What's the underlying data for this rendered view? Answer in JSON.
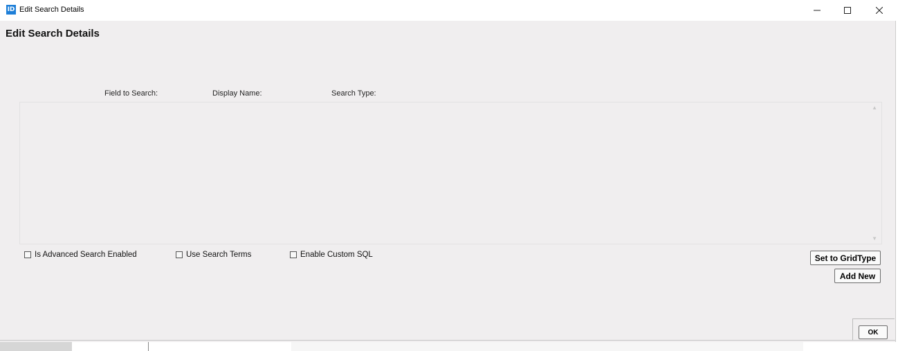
{
  "window": {
    "icon_text": "ID",
    "title": "Edit Search Details",
    "minimize_glyph": "—",
    "maximize_glyph": "☐",
    "close_glyph": "✕"
  },
  "page": {
    "heading": "Edit Search Details"
  },
  "grid": {
    "columns": [
      "Field to Search:",
      "Display Name:",
      "Search Type:"
    ],
    "rows": []
  },
  "options": {
    "advanced_search": {
      "label": "Is Advanced Search Enabled",
      "checked": false
    },
    "use_search_terms": {
      "label": "Use Search Terms",
      "checked": false
    },
    "custom_sql": {
      "label": "Enable Custom SQL",
      "checked": false
    }
  },
  "buttons": {
    "set_grid_type": "Set to GridType",
    "add_new": "Add New",
    "ok": "OK"
  },
  "colors": {
    "client_background": "#f0eeef",
    "icon_accent": "#1e7fd8"
  }
}
